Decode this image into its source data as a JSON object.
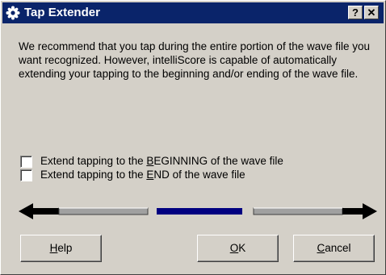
{
  "window": {
    "title": "Tap Extender",
    "help_glyph": "?",
    "close_glyph": "✕",
    "title_icon": "gear-icon",
    "titlebar_color": "#0a246a"
  },
  "message": {
    "text": "We recommend that you tap during the entire portion of the wave file you want recognized.  However, intelliScore is capable of automatically extending your tapping to the beginning and/or ending of the wave file."
  },
  "options": {
    "extend_beginning": {
      "label_pre": "Extend tapping to the ",
      "label_mnemonic": "B",
      "label_post": "EGINNING of the wave file",
      "checked": false
    },
    "extend_end": {
      "label_pre": "Extend tapping to the ",
      "label_mnemonic": "E",
      "label_post": "ND of the wave file",
      "checked": false
    }
  },
  "timeline": {
    "left_arrow_icon": "arrow-left-icon",
    "right_arrow_icon": "arrow-right-icon",
    "segment_colors": {
      "extension": "#a0a0a0",
      "tapped": "#000080"
    }
  },
  "buttons": {
    "help": {
      "mnemonic": "H",
      "rest": "elp"
    },
    "ok": {
      "mnemonic": "O",
      "rest": "K"
    },
    "cancel": {
      "mnemonic": "C",
      "rest": "ancel"
    }
  }
}
